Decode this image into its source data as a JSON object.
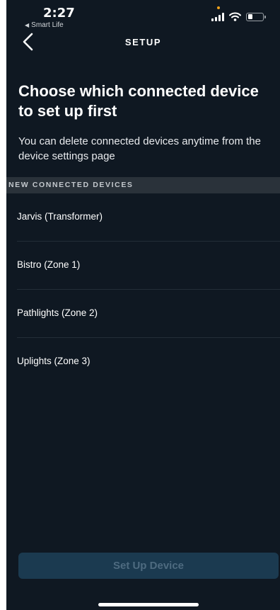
{
  "status_bar": {
    "time": "2:27",
    "back_app": "Smart Life",
    "icons": [
      "signal-icon",
      "wifi-icon",
      "battery-icon"
    ]
  },
  "header": {
    "title": "SETUP",
    "back_icon": "chevron-left-icon"
  },
  "main": {
    "title": "Choose which connected device to set up first",
    "subtitle": "You can delete connected devices anytime from the device settings page",
    "section_header": "NEW CONNECTED DEVICES",
    "devices": [
      {
        "label": "Jarvis (Transformer)"
      },
      {
        "label": "Bistro (Zone 1)"
      },
      {
        "label": "Pathlights (Zone 2)"
      },
      {
        "label": "Uplights (Zone 3)"
      }
    ]
  },
  "footer": {
    "button_label": "Set Up Device",
    "button_state": "disabled"
  },
  "colors": {
    "background": "#0f1822",
    "section_header_bg": "#2a323a",
    "button_bg": "#1b3a50",
    "button_text": "#4e6b80",
    "recording_dot": "#f0a21a"
  }
}
